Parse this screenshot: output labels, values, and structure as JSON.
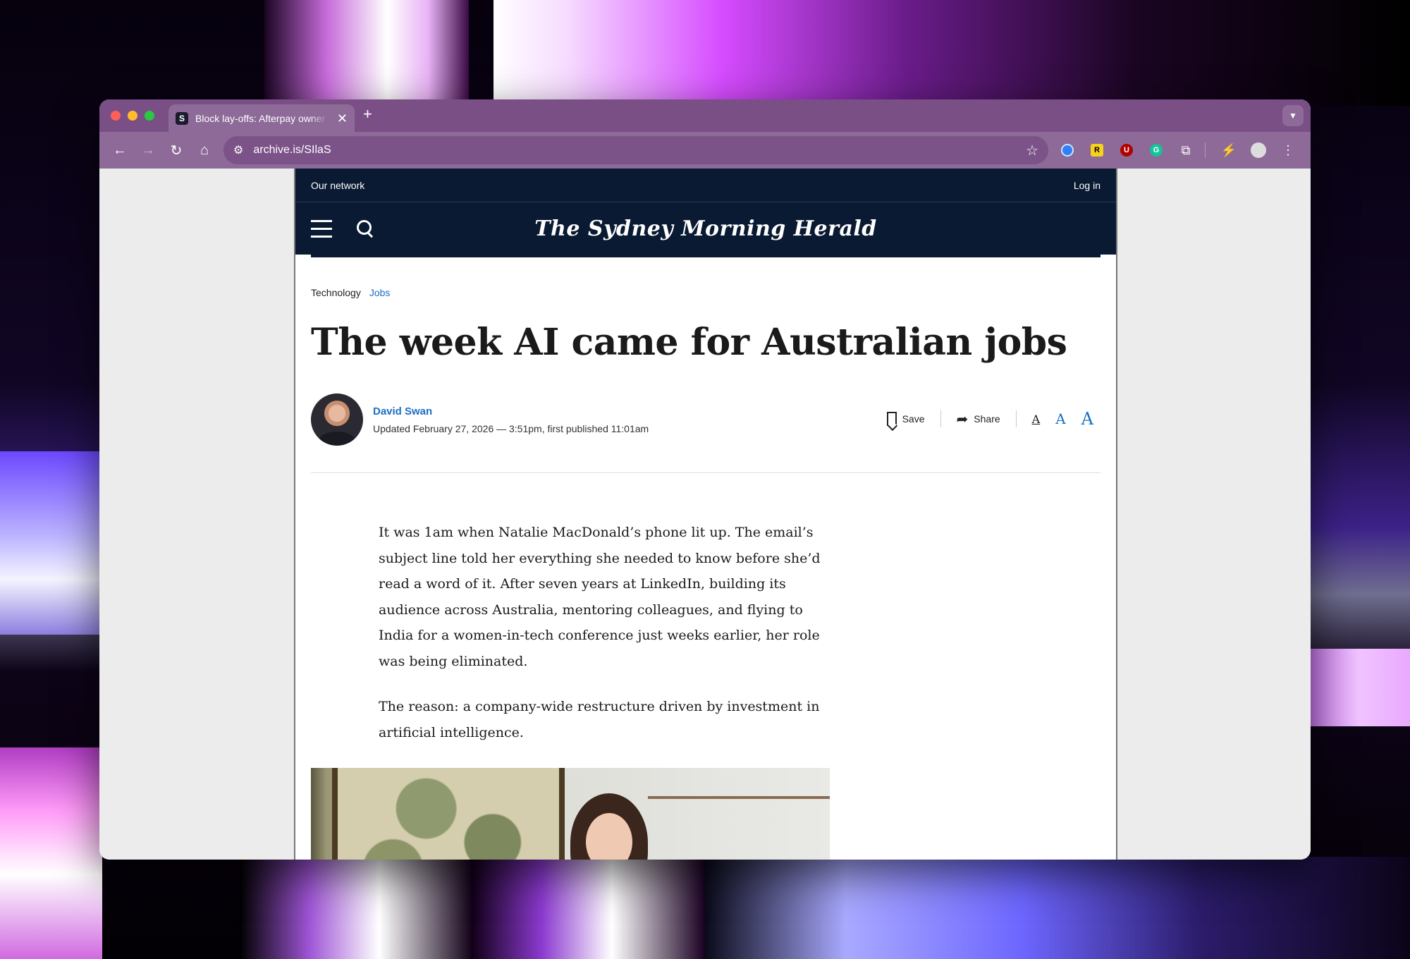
{
  "browser": {
    "tab_title": "Block lay-offs: Afterpay owner",
    "tab_favicon": "S",
    "url": "archive.is/SIlaS",
    "extensions": [
      {
        "name": "1password-icon",
        "label": "",
        "color": "#2f7ff7"
      },
      {
        "name": "r-extension-icon",
        "label": "R",
        "color": "#f6d21b"
      },
      {
        "name": "ublock-icon",
        "label": "U",
        "color": "#b30000"
      },
      {
        "name": "grammarly-icon",
        "label": "G",
        "color": "#15c39a"
      }
    ]
  },
  "site": {
    "network_link": "Our network",
    "login_link": "Log in",
    "logo_text": "The Sydney Morning Herald"
  },
  "article": {
    "breadcrumb": [
      "Technology",
      "Jobs"
    ],
    "headline": "The week AI came for Australian jobs",
    "author": "David Swan",
    "updated": "Updated February 27, 2026 — 3:51pm, first published 11:01am",
    "save_label": "Save",
    "share_label": "Share",
    "font_size_glyph": "A",
    "paragraphs": [
      "It was 1am when Natalie MacDonald’s phone lit up. The email’s subject line told her everything she needed to know before she’d read a word of it. After seven years at LinkedIn, building its audience across Australia, mentoring colleagues, and flying to India for a women-in-tech conference just weeks earlier, her role was being eliminated.",
      "The reason: a company-wide restructure driven by investment in artificial intelligence."
    ]
  }
}
